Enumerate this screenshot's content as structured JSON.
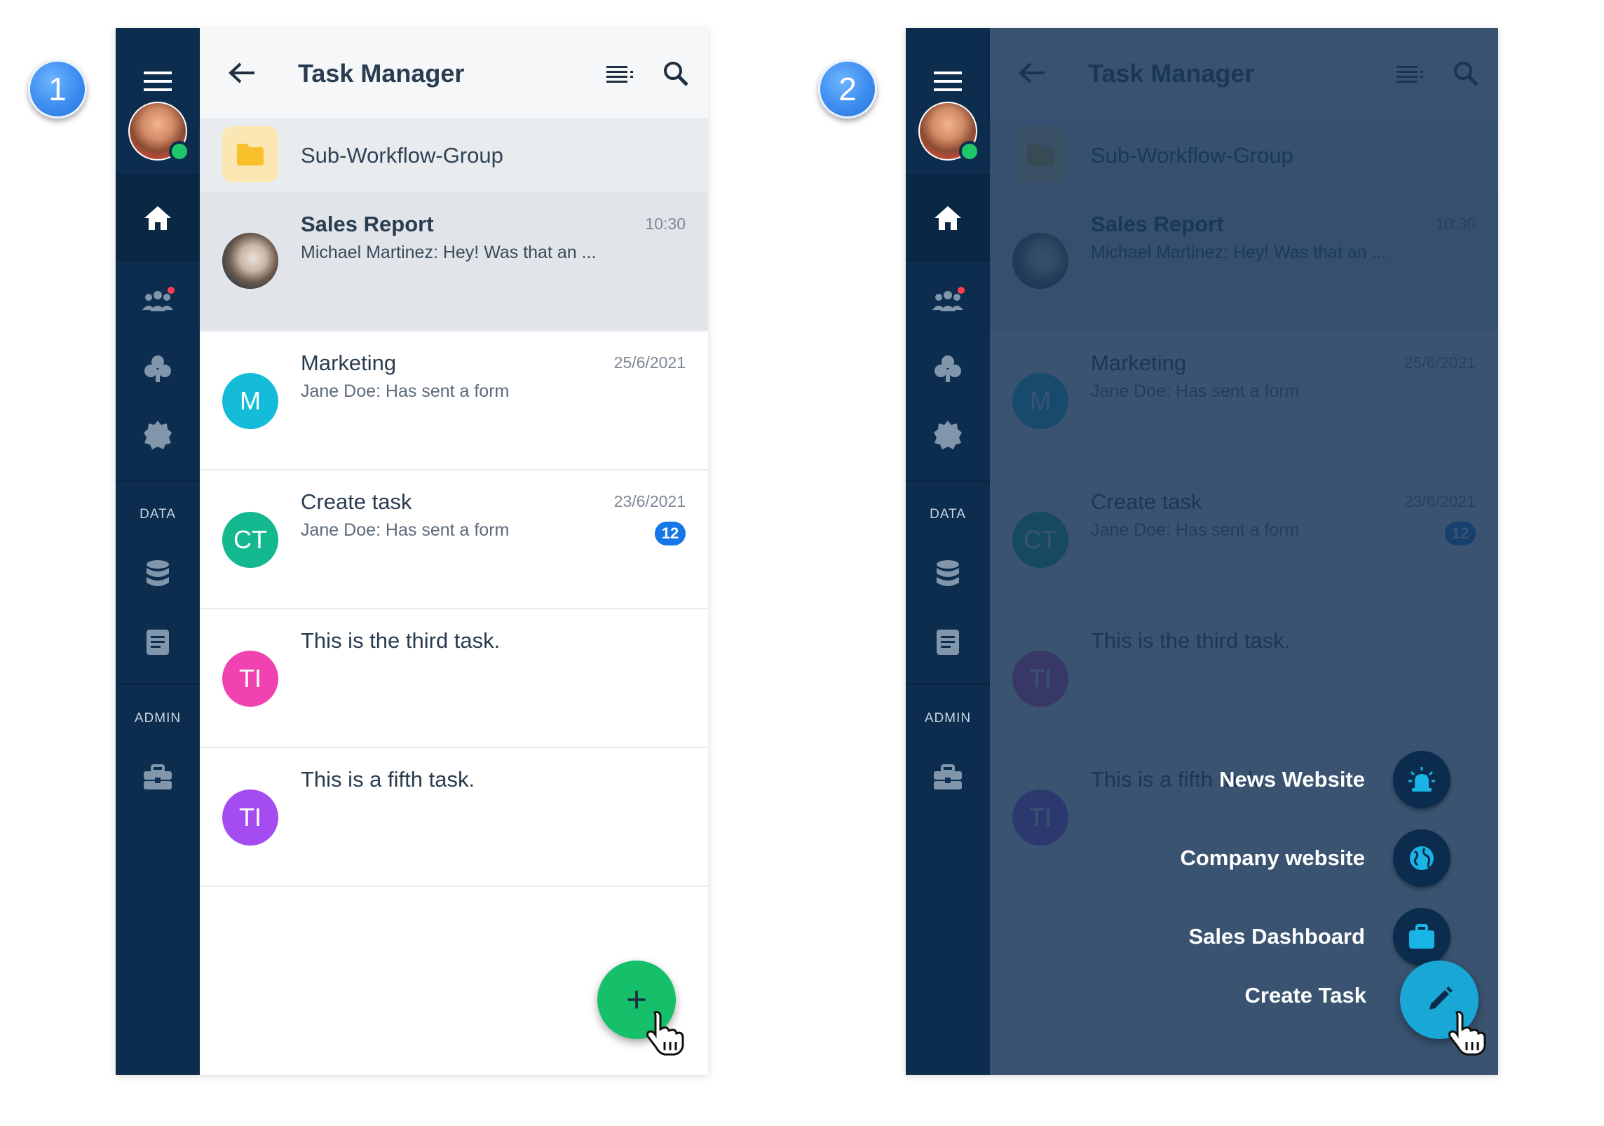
{
  "steps": [
    "1",
    "2"
  ],
  "rail": {
    "section_data": "DATA",
    "section_admin": "ADMIN",
    "icons": [
      "menu-icon",
      "avatar",
      "home-icon",
      "team-icon",
      "club-icon",
      "badge-icon",
      "database-icon",
      "document-icon",
      "toolbox-icon"
    ]
  },
  "header": {
    "title": "Task Manager"
  },
  "group": {
    "label": "Sub-Workflow-Group"
  },
  "rows": [
    {
      "name": "Sales Report",
      "message": "Michael Martinez: Hey! Was that an ...",
      "time": "10:30",
      "initials": ""
    },
    {
      "name": "Marketing",
      "message": "Jane Doe: Has sent a form",
      "time": "25/6/2021",
      "initials": "M"
    },
    {
      "name": "Create task",
      "message": "Jane Doe: Has sent a form",
      "time": "23/6/2021",
      "initials": "CT",
      "count": "12"
    },
    {
      "name": "This is the third task.",
      "message": "",
      "time": "",
      "initials": "TI"
    },
    {
      "name": "This is a fifth task.",
      "message": "",
      "time": "",
      "initials": "TI"
    }
  ],
  "fab": {
    "add_symbol": "+"
  },
  "speed_dial": {
    "items": [
      "News Website",
      "Company website",
      "Sales Dashboard"
    ],
    "create": "Create Task"
  },
  "colors": {
    "rail": "#0c2d4d",
    "accent_green": "#16c06a",
    "accent_blue": "#19a7d6",
    "avatar_m": "#14bcd9",
    "avatar_ct": "#13b88e",
    "avatar_ti1": "#f043b1",
    "avatar_ti2": "#a44cf0",
    "badge": "#1677e8"
  }
}
